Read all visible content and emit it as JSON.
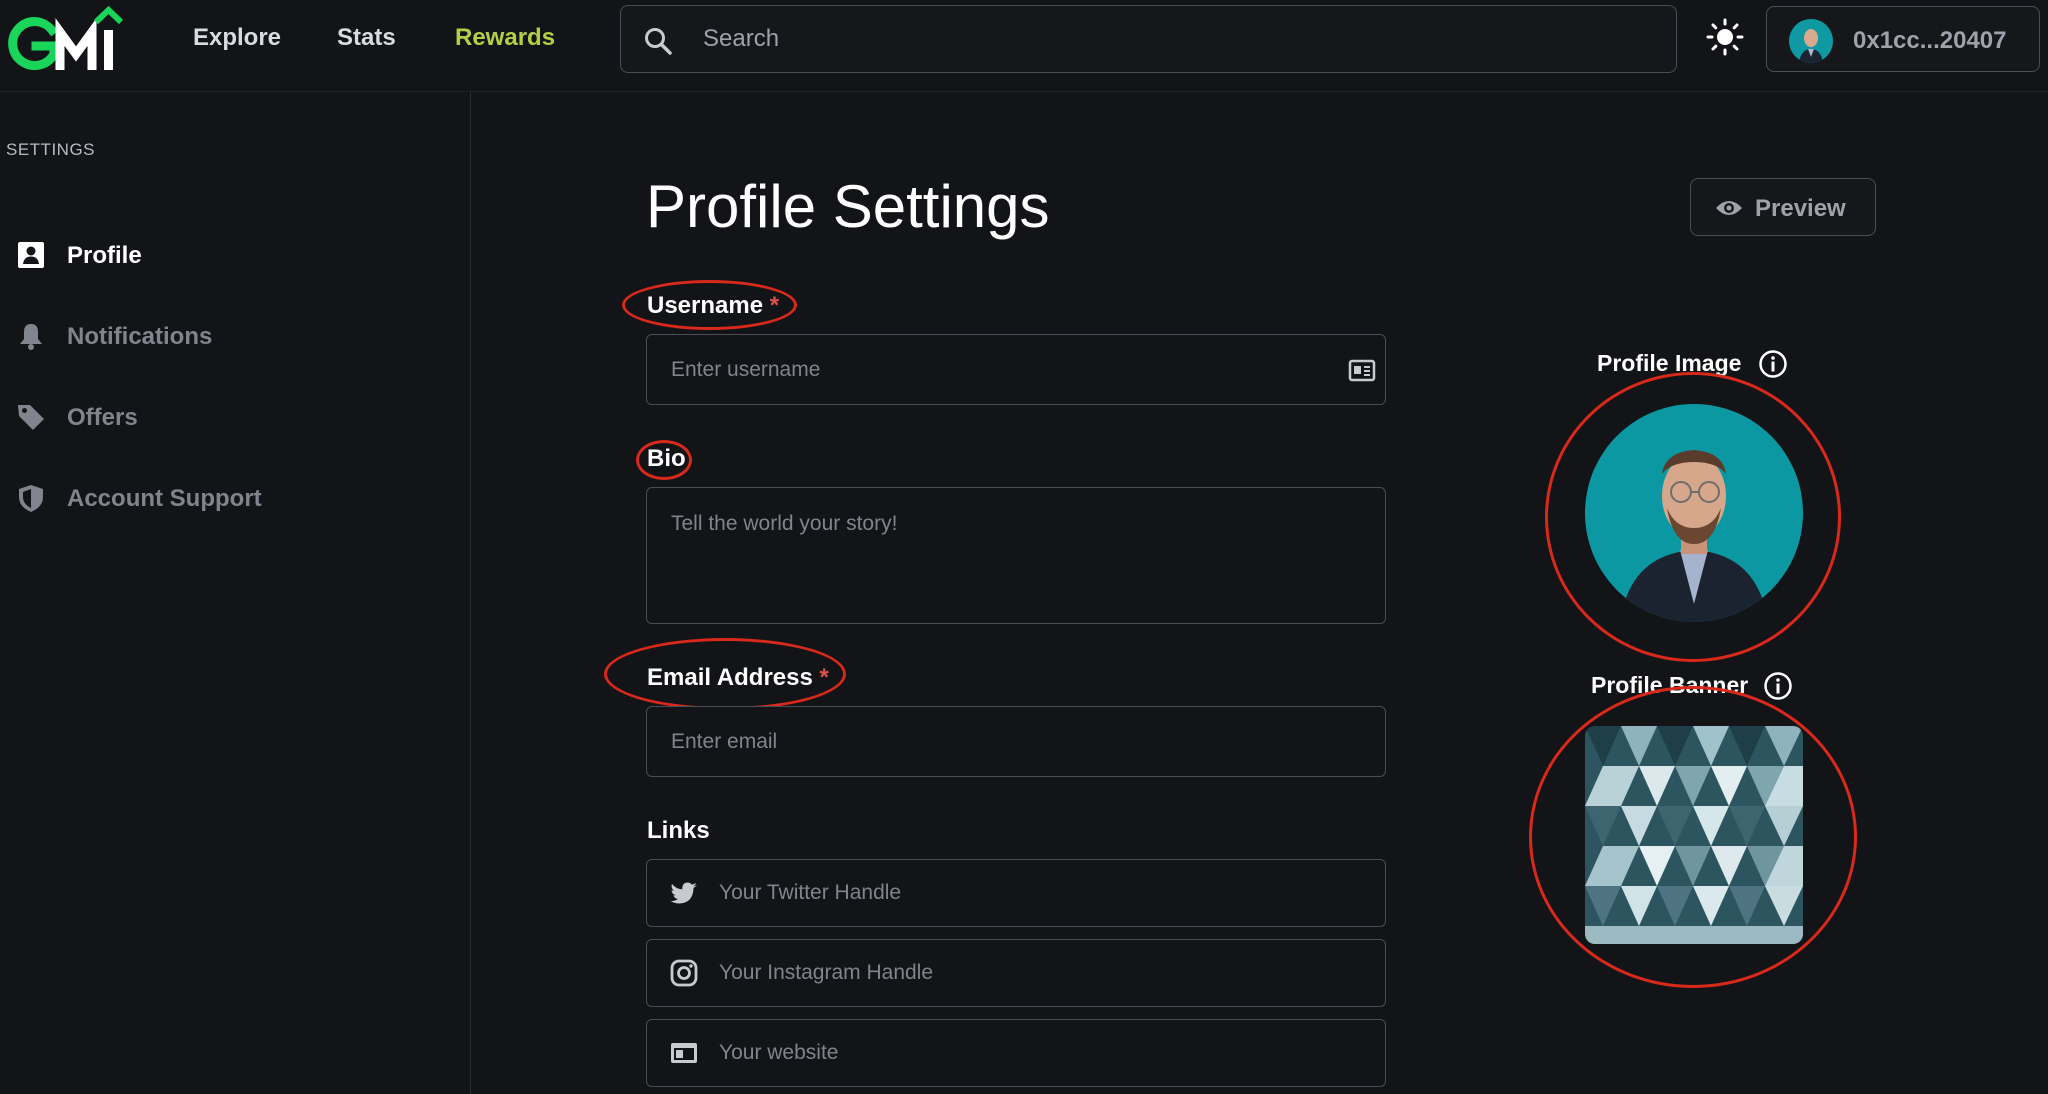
{
  "header": {
    "logo_text": "GMI",
    "nav": [
      {
        "label": "Explore"
      },
      {
        "label": "Stats"
      },
      {
        "label": "Rewards"
      }
    ],
    "search_placeholder": "Search",
    "wallet_address": "0x1cc...20407"
  },
  "sidebar": {
    "title": "SETTINGS",
    "items": [
      {
        "label": "Profile",
        "icon": "profile-card-icon"
      },
      {
        "label": "Notifications",
        "icon": "bell-icon"
      },
      {
        "label": "Offers",
        "icon": "tag-icon"
      },
      {
        "label": "Account Support",
        "icon": "shield-icon"
      }
    ]
  },
  "main": {
    "title": "Profile Settings",
    "preview_label": "Preview",
    "username": {
      "label": "Username",
      "required_mark": "*",
      "placeholder": "Enter username",
      "value": ""
    },
    "bio": {
      "label": "Bio",
      "placeholder": "Tell the world your story!",
      "value": ""
    },
    "email": {
      "label": "Email Address",
      "required_mark": "*",
      "placeholder": "Enter email",
      "value": ""
    },
    "links": {
      "label": "Links",
      "twitter_placeholder": "Your Twitter Handle",
      "instagram_placeholder": "Your Instagram Handle",
      "website_placeholder": "Your website"
    },
    "profile_image_label": "Profile Image",
    "profile_banner_label": "Profile Banner"
  },
  "colors": {
    "background": "#131417",
    "accent_green": "#19d65a",
    "rewards_color": "#b5cf45",
    "required_color": "#e0524f",
    "annotation_red": "#d8291a"
  }
}
